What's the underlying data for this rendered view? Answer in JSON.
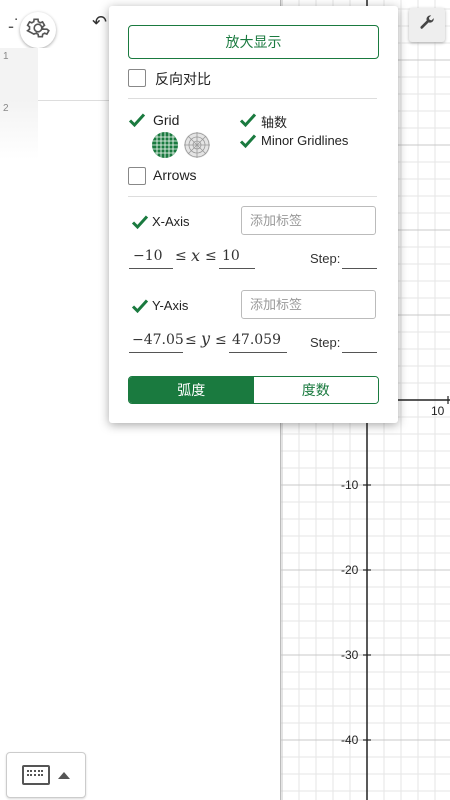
{
  "toolbar": {
    "menu_icon": "gear-icon",
    "undo_icon": "undo-icon",
    "settings_icon": "wrench-icon"
  },
  "algebra": {
    "rows": [
      "1",
      "2"
    ]
  },
  "keyboard": {
    "icon": "keyboard-icon"
  },
  "graph": {
    "x_tick_labels": [
      "10"
    ],
    "y_tick_labels": [
      "-10",
      "-20",
      "-30",
      "-40"
    ]
  },
  "settings": {
    "zoom_button": "放大显示",
    "reverse_contrast": {
      "label": "反向对比",
      "checked": false
    },
    "grid": {
      "label": "Grid",
      "checked": true
    },
    "axes": {
      "label": "轴数",
      "checked": true
    },
    "minor_gridlines": {
      "label": "Minor Gridlines",
      "checked": true
    },
    "arrows": {
      "label": "Arrows",
      "checked": false
    },
    "x_axis": {
      "label": "X-Axis",
      "checked": true,
      "placeholder": "添加标签",
      "min": "−10",
      "max": "10",
      "var": "x",
      "step_label": "Step:"
    },
    "y_axis": {
      "label": "Y-Axis",
      "checked": true,
      "placeholder": "添加标签",
      "min": "−47.05",
      "max": "47.059",
      "var": "y",
      "step_label": "Step:"
    },
    "angle_units": {
      "radians": "弧度",
      "degrees": "度数",
      "selected": "弧度"
    }
  },
  "colors": {
    "accent": "#1a7a3f",
    "grid_major": "#c8c8c8",
    "grid_minor": "#e6e6e6"
  }
}
